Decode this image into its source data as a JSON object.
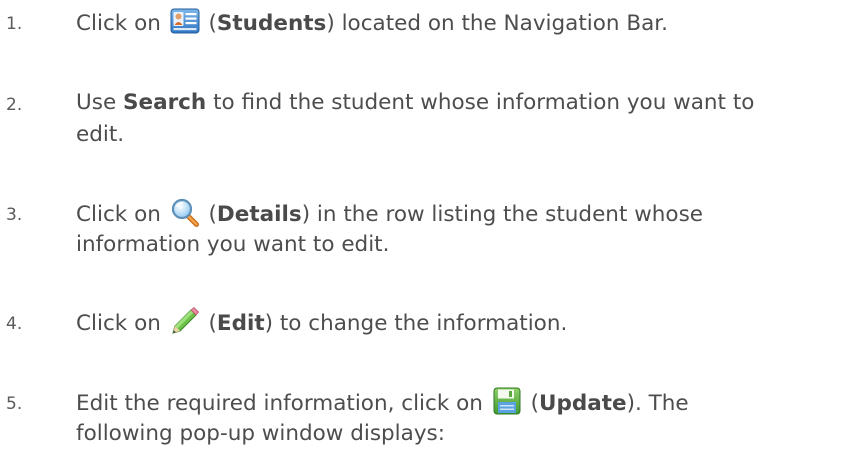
{
  "steps": [
    {
      "number": "1.",
      "lines": [
        {
          "pre": "Click on ",
          "icon": "students-icon",
          "open": " (",
          "bold": "Students",
          "close": ") located on the Navigation Bar."
        }
      ]
    },
    {
      "number": "2.",
      "lines": [
        {
          "pre": "Use ",
          "bold": "Search",
          "post": " to find the student whose information you want to"
        },
        {
          "text": "edit."
        }
      ]
    },
    {
      "number": "3.",
      "lines": [
        {
          "pre": "Click on ",
          "icon": "magnifier-icon",
          "open": " (",
          "bold": "Details",
          "close": ") in the row listing the student whose"
        },
        {
          "text": "information you want to edit."
        }
      ]
    },
    {
      "number": "4.",
      "lines": [
        {
          "pre": "Click on ",
          "icon": "pencil-icon",
          "open": " (",
          "bold": "Edit",
          "close": ") to change the information."
        }
      ]
    },
    {
      "number": "5.",
      "lines": [
        {
          "pre": "Edit the required information, click on ",
          "icon": "floppy-disk-icon",
          "open": " (",
          "bold": "Update",
          "close": ").  The"
        },
        {
          "text": "following pop-up window displays:"
        }
      ]
    }
  ]
}
